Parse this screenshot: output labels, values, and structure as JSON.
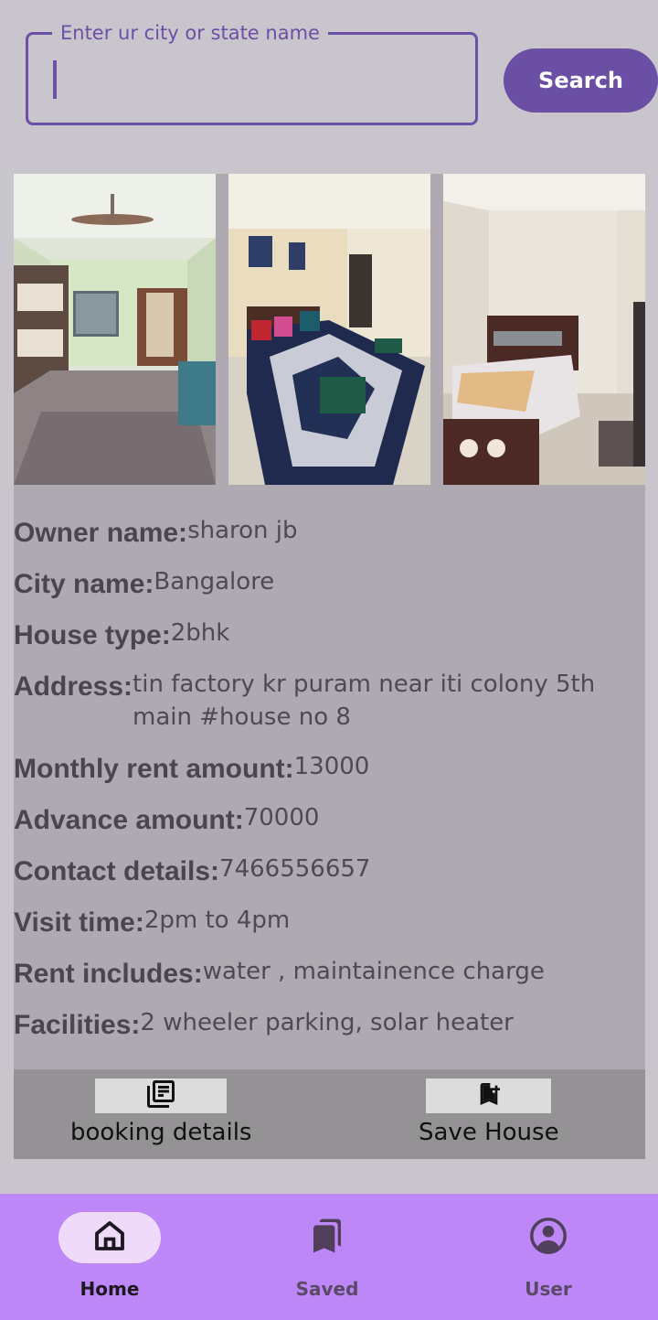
{
  "search": {
    "label": "Enter ur city or state name",
    "value": "",
    "button_label": "Search"
  },
  "listing": {
    "details": [
      {
        "key": "Owner name:",
        "value": "sharon jb"
      },
      {
        "key": "City name:",
        "value": "Bangalore"
      },
      {
        "key": "House type:",
        "value": "2bhk"
      },
      {
        "key": "Address:",
        "value": "tin factory kr puram near iti colony 5th main #house no 8"
      },
      {
        "key": "Monthly rent amount:",
        "value": "13000"
      },
      {
        "key": "Advance amount:",
        "value": "70000"
      },
      {
        "key": "Contact details:",
        "value": "7466556657"
      },
      {
        "key": "Visit time:",
        "value": "2pm to 4pm"
      },
      {
        "key": "Rent includes:",
        "value": "water , maintainence charge"
      },
      {
        "key": "Facilities:",
        "value": "2 wheeler parking, solar heater"
      }
    ],
    "actions": {
      "booking_label": "booking details",
      "save_label": "Save House"
    }
  },
  "bottom_nav": {
    "items": [
      {
        "label": "Home",
        "icon": "home-icon",
        "active": true
      },
      {
        "label": "Saved",
        "icon": "bookmarks-icon",
        "active": false
      },
      {
        "label": "User",
        "icon": "account-circle-icon",
        "active": false
      }
    ]
  },
  "colors": {
    "accent": "#6a4fa4",
    "nav_background": "#bd87f7",
    "card_background": "#afaab1",
    "screen_background": "#c9c5cc"
  }
}
